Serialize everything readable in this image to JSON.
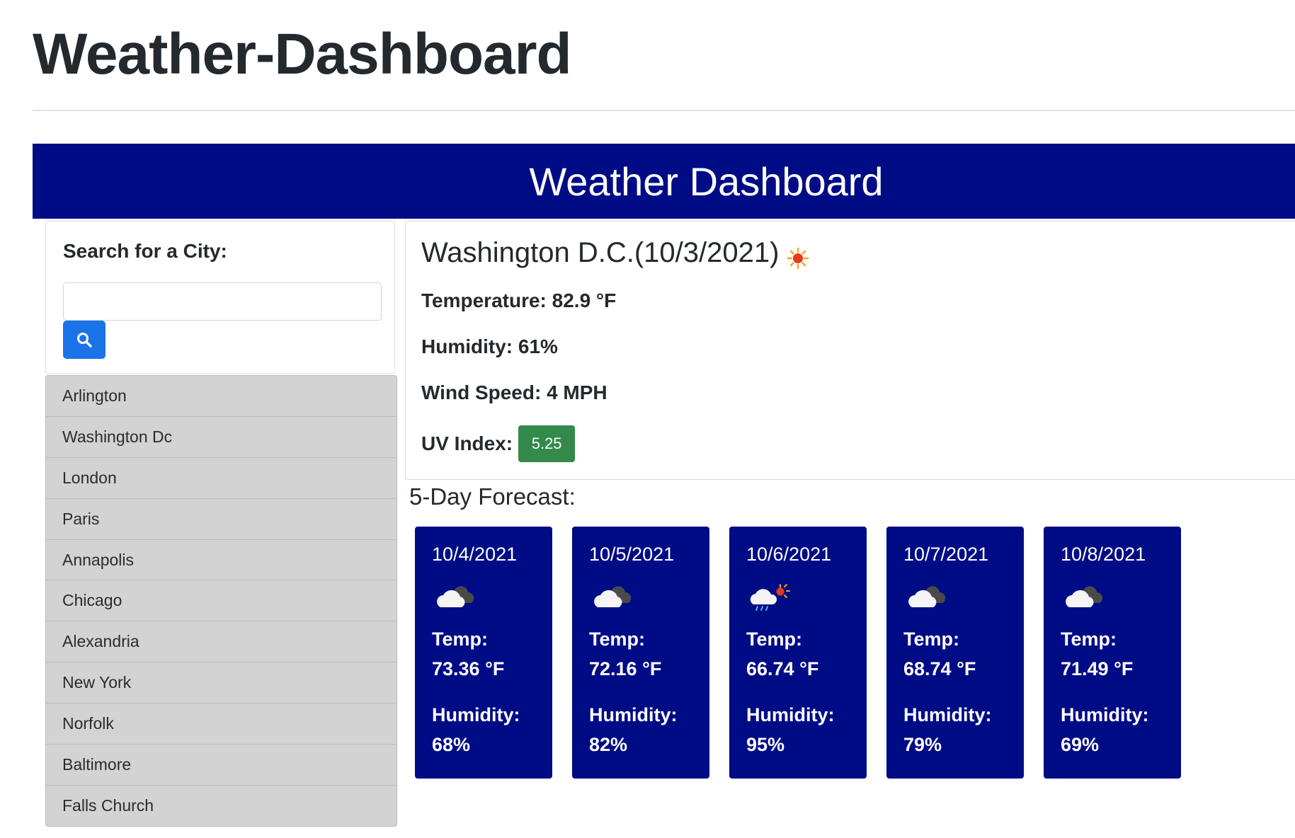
{
  "page": {
    "title": "Weather-Dashboard"
  },
  "banner": {
    "title": "Weather Dashboard"
  },
  "search": {
    "label": "Search for a City:",
    "placeholder": "",
    "value": "",
    "button_icon": "search-icon"
  },
  "history": [
    "Arlington",
    "Washington Dc",
    "London",
    "Paris",
    "Annapolis",
    "Chicago",
    "Alexandria",
    "New York",
    "Norfolk",
    "Baltimore",
    "Falls Church"
  ],
  "current": {
    "city_date": "Washington D.C.(10/3/2021)",
    "icon": "sun-icon",
    "temperature": "Temperature: 82.9 °F",
    "humidity": "Humidity: 61%",
    "wind": "Wind Speed: 4 MPH",
    "uv_label": "UV Index:",
    "uv_value": "5.25",
    "uv_color": "#338a4a"
  },
  "forecast": {
    "heading": "5-Day Forecast:",
    "days": [
      {
        "date": "10/4/2021",
        "icon": "cloud-icon",
        "temp_label": "Temp:",
        "temp": "73.36 °F",
        "humidity_label": "Humidity:",
        "humidity": "68%"
      },
      {
        "date": "10/5/2021",
        "icon": "cloud-icon",
        "temp_label": "Temp:",
        "temp": "72.16 °F",
        "humidity_label": "Humidity:",
        "humidity": "82%"
      },
      {
        "date": "10/6/2021",
        "icon": "rain-sun-icon",
        "temp_label": "Temp:",
        "temp": "66.74 °F",
        "humidity_label": "Humidity:",
        "humidity": "95%"
      },
      {
        "date": "10/7/2021",
        "icon": "cloud-icon",
        "temp_label": "Temp:",
        "temp": "68.74 °F",
        "humidity_label": "Humidity:",
        "humidity": "79%"
      },
      {
        "date": "10/8/2021",
        "icon": "cloud-icon",
        "temp_label": "Temp:",
        "temp": "71.49 °F",
        "humidity_label": "Humidity:",
        "humidity": "69%"
      }
    ]
  },
  "colors": {
    "banner": "#000c86",
    "forecast_card": "#000c86",
    "search_button": "#1a73e8",
    "history_bg": "#d3d3d3"
  }
}
